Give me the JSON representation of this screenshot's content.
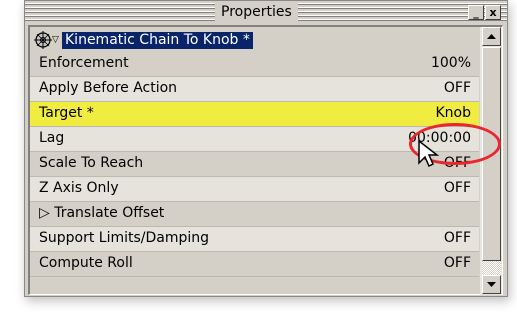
{
  "window": {
    "title": "Properties",
    "minimize_label": "_",
    "close_label": "x"
  },
  "header": {
    "title": "Kinematic Chain To Knob *",
    "icon": "gear-icon",
    "expand_icon": "triangle-down-icon"
  },
  "rows": [
    {
      "label": "Enforcement",
      "value": "100%"
    },
    {
      "label": "Apply Before Action",
      "value": "OFF"
    },
    {
      "label": "Target *",
      "value": "Knob",
      "highlight": true
    },
    {
      "label": "Lag",
      "value": "00:00:00"
    },
    {
      "label": "Scale To Reach",
      "value": "OFF"
    },
    {
      "label": "Z Axis Only",
      "value": "OFF"
    },
    {
      "label": "▷ Translate Offset",
      "value": ""
    },
    {
      "label": "Support Limits/Damping",
      "value": "OFF"
    },
    {
      "label": "Compute Roll",
      "value": "OFF"
    }
  ],
  "colors": {
    "highlight_row": "#f0ec40",
    "callout": "#e8282d",
    "selection": "#0a246a"
  }
}
